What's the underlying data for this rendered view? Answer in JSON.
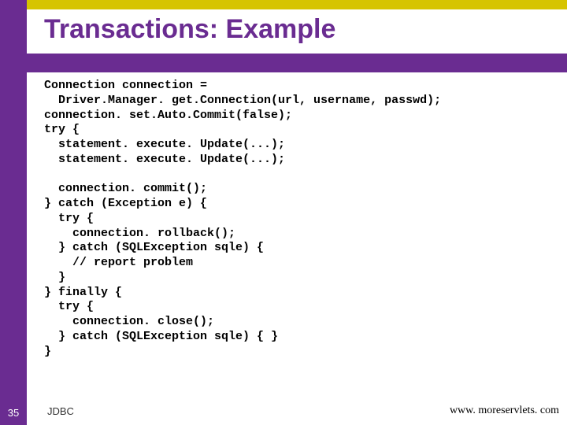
{
  "slide": {
    "title": "Transactions: Example",
    "page_number": "35",
    "footer_label": "JDBC",
    "footer_url": "www. moreservlets. com"
  },
  "code": "Connection connection =\n  Driver.Manager. get.Connection(url, username, passwd);\nconnection. set.Auto.Commit(false);\ntry {\n  statement. execute. Update(...);\n  statement. execute. Update(...);\n\n  connection. commit();\n} catch (Exception e) {\n  try {\n    connection. rollback();\n  } catch (SQLException sqle) {\n    // report problem\n  }\n} finally {\n  try {\n    connection. close();\n  } catch (SQLException sqle) { }\n}"
}
